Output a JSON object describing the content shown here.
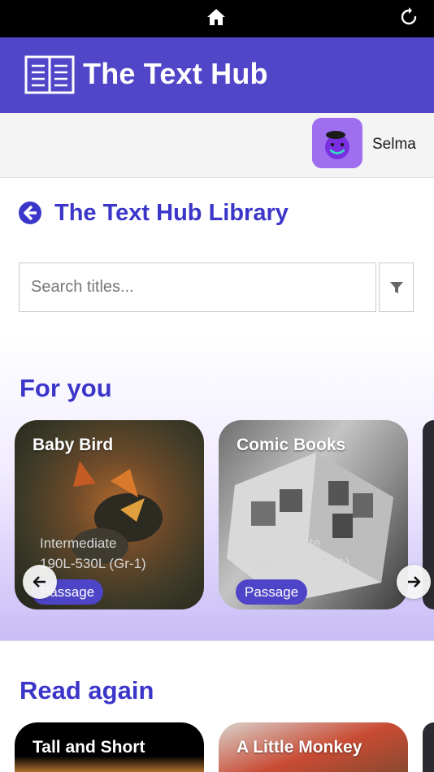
{
  "topbar": {
    "home_icon": "home-icon",
    "refresh_icon": "refresh-icon"
  },
  "brand": {
    "title": "The Text Hub",
    "logo_icon": "open-book-icon",
    "color": "#5146c8"
  },
  "user": {
    "name": "Selma",
    "avatar_icon": "purple-monster-avatar"
  },
  "library": {
    "back_icon": "back-arrow-circle-icon",
    "title": "The Text Hub Library"
  },
  "search": {
    "placeholder": "Search titles...",
    "value": "",
    "filter_icon": "filter-funnel-icon"
  },
  "sections": {
    "for_you": {
      "title": "For you",
      "cards": [
        {
          "title": "Baby Bird",
          "level": "Intermediate",
          "lexile": "190L-530L (Gr-1)",
          "type": "Passage"
        },
        {
          "title": "Comic Books",
          "level": "Intermediate",
          "lexile": "190L-530L (Gr-1)",
          "type": "Passage"
        }
      ],
      "prev_icon": "arrow-left-icon",
      "next_icon": "arrow-right-icon"
    },
    "read_again": {
      "title": "Read again",
      "cards": [
        {
          "title": "Tall and Short"
        },
        {
          "title": "A Little Monkey"
        }
      ]
    }
  },
  "colors": {
    "accent": "#3b36c9",
    "badge": "#4e44c8",
    "topbar": "#000000"
  }
}
